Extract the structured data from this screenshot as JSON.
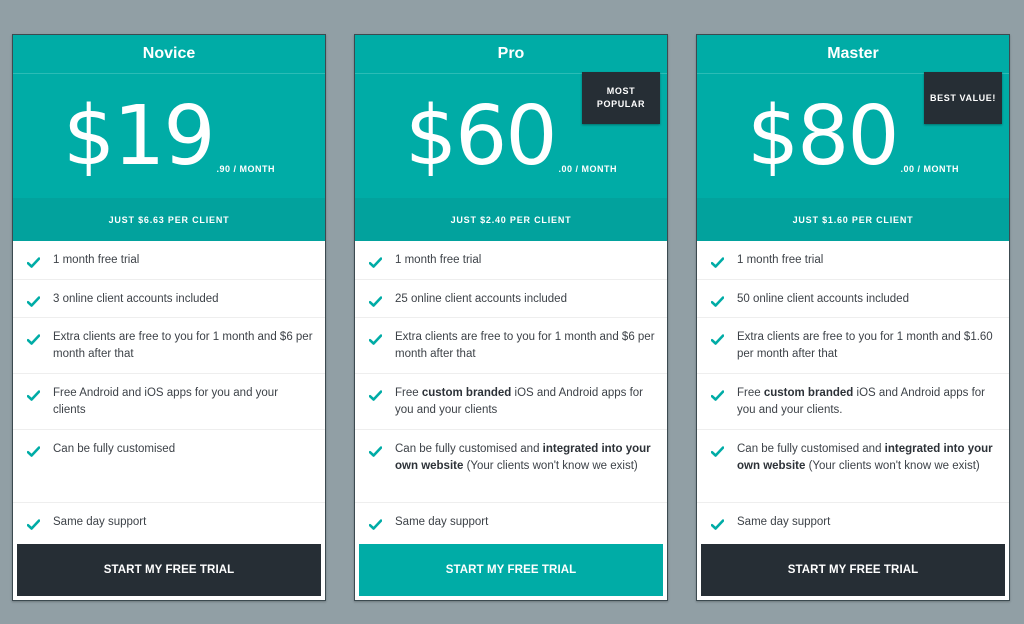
{
  "colors": {
    "brand": "#00aca6",
    "brand_dark": "#02a29d",
    "dark": "#262e35",
    "background": "#919fa5",
    "check": "#00aca6"
  },
  "plans": [
    {
      "name": "Novice",
      "amount": "$19",
      "period": ".90 / MONTH",
      "per_client": "JUST $6.63 PER CLIENT",
      "badge": null,
      "features": [
        {
          "pre": "1 month free trial",
          "bold": "",
          "post": "",
          "bold2": "",
          "post2": ""
        },
        {
          "pre": "3 online client accounts included",
          "bold": "",
          "post": "",
          "bold2": "",
          "post2": ""
        },
        {
          "pre": "Extra clients are free to you for 1 month and $6 per month after that",
          "bold": "",
          "post": "",
          "bold2": "",
          "post2": ""
        },
        {
          "pre": "Free Android and iOS apps for you and your clients",
          "bold": "",
          "post": "",
          "bold2": "",
          "post2": ""
        },
        {
          "pre": "Can be fully customised",
          "bold": "",
          "post": "",
          "bold2": "",
          "post2": ""
        },
        {
          "pre": "Same day support",
          "bold": "",
          "post": "",
          "bold2": "",
          "post2": ""
        }
      ],
      "cta": "START MY FREE TRIAL",
      "cta_icon": "check-icon"
    },
    {
      "name": "Pro",
      "amount": "$60",
      "period": ".00 / MONTH",
      "per_client": "JUST $2.40 PER CLIENT",
      "badge": "MOST POPULAR",
      "features": [
        {
          "pre": "1 month free trial",
          "bold": "",
          "post": ""
        },
        {
          "pre": "25 online client accounts included",
          "bold": "",
          "post": ""
        },
        {
          "pre": "Extra clients are free to you for 1 month and $6 per month after that",
          "bold": "",
          "post": ""
        },
        {
          "pre": "Free ",
          "bold": "custom branded",
          "post": " iOS and Android apps for you and your clients"
        },
        {
          "pre": "Can be fully customised and ",
          "bold": "integrated into your own website",
          "post": " (Your clients won't know we exist)"
        },
        {
          "pre": "Same day support",
          "bold": "",
          "post": ""
        }
      ],
      "cta": "START MY FREE TRIAL"
    },
    {
      "name": "Master",
      "amount": "$80",
      "period": ".00 / MONTH",
      "per_client": "JUST $1.60 PER CLIENT",
      "badge": "BEST VALUE!",
      "features": [
        {
          "pre": "1 month free trial",
          "bold": "",
          "post": ""
        },
        {
          "pre": "50 online client accounts included",
          "bold": "",
          "post": ""
        },
        {
          "pre": "Extra clients are free to you for 1 month and $1.60 per month after that",
          "bold": "",
          "post": ""
        },
        {
          "pre": "Free ",
          "bold": "custom branded",
          "post": " iOS and Android apps for you and your clients."
        },
        {
          "pre": "Can be fully customised and ",
          "bold": "integrated into your own website",
          "post": " (Your clients won't know we exist)"
        },
        {
          "pre": "Same day support",
          "bold": "",
          "post": ""
        }
      ],
      "cta": "START MY FREE TRIAL"
    }
  ]
}
